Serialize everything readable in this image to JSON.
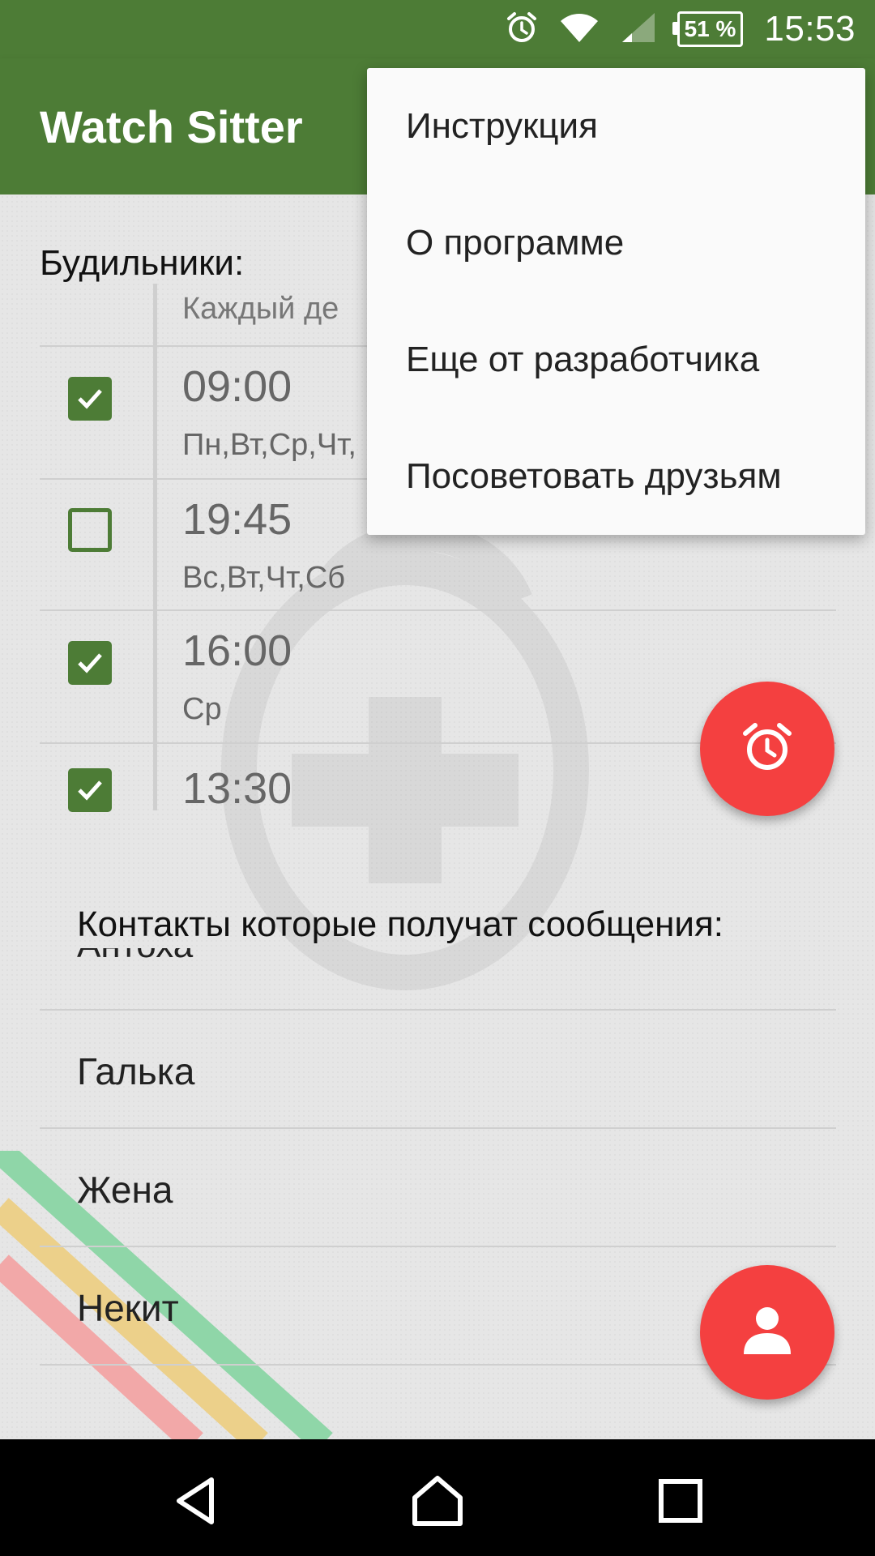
{
  "status_bar": {
    "battery": "51 %",
    "time": "15:53",
    "icons": [
      "alarm-icon",
      "wifi-icon",
      "signal-icon",
      "battery-icon"
    ]
  },
  "app_bar": {
    "title": "Watch Sitter"
  },
  "overflow_menu": {
    "items": [
      {
        "label": "Инструкция"
      },
      {
        "label": "О программе"
      },
      {
        "label": "Еще от разработчика"
      },
      {
        "label": "Посоветовать друзьям"
      }
    ]
  },
  "alarms": {
    "heading": "Будильники:",
    "column_header": "Каждый де",
    "rows": [
      {
        "time": "09:00",
        "days": "Пн,Вт,Ср,Чт,",
        "checked": true
      },
      {
        "time": "19:45",
        "days": "Вс,Вт,Чт,Сб",
        "checked": false
      },
      {
        "time": "16:00",
        "days": "Ср",
        "checked": true
      },
      {
        "time": "13:30",
        "days": "",
        "checked": true
      }
    ]
  },
  "contacts": {
    "heading": "Контакты которые получат сообщения:",
    "partial_item": "Антоха",
    "items": [
      {
        "name": "Галька"
      },
      {
        "name": "Жена"
      },
      {
        "name": "Некит"
      }
    ]
  },
  "fabs": {
    "add_alarm_icon": "alarm-clock-icon",
    "add_contact_icon": "person-icon"
  },
  "colors": {
    "primary": "#4d7c36",
    "accent": "#f44040",
    "menu_bg": "#fafafa"
  }
}
